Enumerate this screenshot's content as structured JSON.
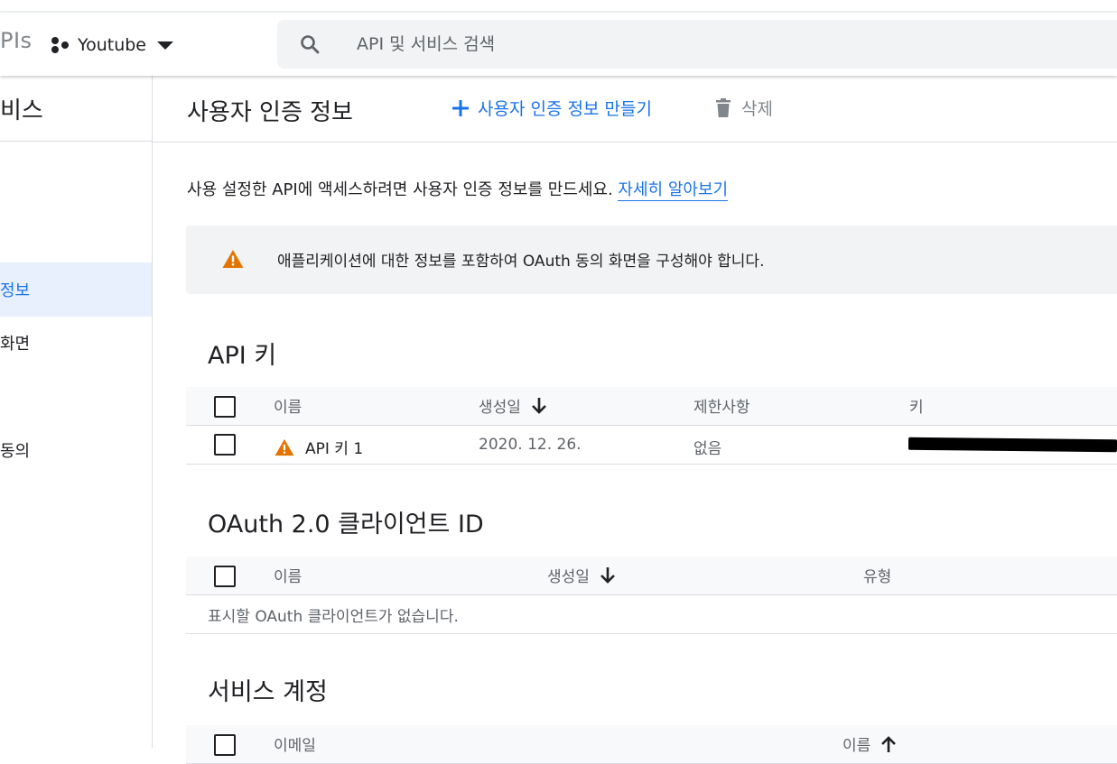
{
  "header": {
    "brand_fragment": "PIs",
    "project_name": "Youtube",
    "search_placeholder": "API 및 서비스 검색"
  },
  "sidebar": {
    "title_fragment": "비스",
    "items": [
      {
        "label": "정보",
        "active": true
      },
      {
        "label": "화면",
        "active": false
      },
      {
        "label": "동의",
        "active": false
      }
    ]
  },
  "page": {
    "title": "사용자 인증 정보",
    "create_label": "사용자 인증 정보 만들기",
    "delete_label": "삭제",
    "intro_text": "사용 설정한 API에 액세스하려면 사용자 인증 정보를 만드세요. ",
    "learn_more": "자세히 알아보기",
    "warning_text": "애플리케이션에 대한 정보를 포함하여 OAuth 동의 화면을 구성해야 합니다."
  },
  "api_keys": {
    "title": "API 키",
    "columns": [
      "이름",
      "생성일",
      "제한사항",
      "키"
    ],
    "rows": [
      {
        "name": "API 키 1",
        "created": "2020. 12. 26.",
        "restrictions": "없음"
      }
    ]
  },
  "oauth": {
    "title": "OAuth 2.0 클라이언트 ID",
    "columns": [
      "이름",
      "생성일",
      "유형"
    ],
    "empty_text": "표시할 OAuth 클라이언트가 없습니다."
  },
  "service_accounts": {
    "title": "서비스 계정",
    "columns": [
      "이메일",
      "이름"
    ]
  },
  "colors": {
    "accent": "#1a73e8",
    "warning": "#e37400",
    "active_bg": "#e8f0fe"
  }
}
